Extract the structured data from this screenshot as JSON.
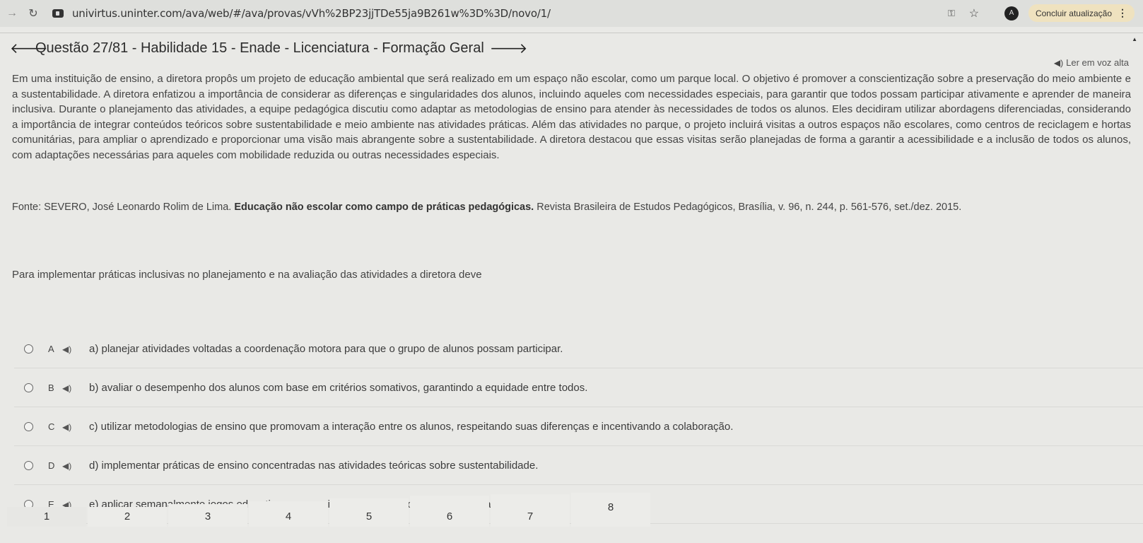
{
  "browser": {
    "url": "univirtus.uninter.com/ava/web/#/ava/provas/vVh%2BP23jjTDe55ja9B261w%3D%3D/novo/1/",
    "profile_initial": "A",
    "update_label": "Concluir atualização"
  },
  "header": {
    "title": "Questão 27/81 - Habilidade 15 - Enade - Licenciatura - Formação Geral",
    "read_aloud": "Ler em voz alta"
  },
  "question": {
    "paragraph": "Em uma instituição de ensino, a diretora propôs um projeto de educação ambiental que será realizado em um espaço não escolar, como um parque local. O objetivo é promover a conscientização sobre a preservação do meio ambiente e a sustentabilidade. A diretora enfatizou a importância de considerar as diferenças e singularidades dos alunos, incluindo aqueles com necessidades especiais, para garantir que todos possam participar ativamente e aprender de maneira inclusiva. Durante o planejamento das atividades, a equipe pedagógica discutiu como adaptar as metodologias de ensino para atender às necessidades de todos os alunos. Eles decidiram utilizar abordagens diferenciadas, considerando a importância de integrar conteúdos teóricos sobre sustentabilidade e meio ambiente nas atividades práticas. Além das atividades no parque, o projeto incluirá visitas a outros espaços não escolares, como centros de reciclagem e hortas comunitárias, para ampliar o aprendizado e proporcionar uma visão mais abrangente sobre a sustentabilidade. A diretora destacou que essas visitas serão planejadas de forma a garantir a acessibilidade e a inclusão de todos os alunos, com adaptações necessárias para aqueles com mobilidade reduzida ou outras necessidades especiais.",
    "source_prefix": "Fonte:  SEVERO, José Leonardo Rolim de Lima. ",
    "source_title": "Educação não escolar como campo de práticas pedagógicas.",
    "source_suffix": " Revista Brasileira de Estudos Pedagógicos, Brasília, v. 96, n. 244, p. 561-576, set./dez. 2015.",
    "prompt": "Para implementar práticas inclusivas no planejamento e na avaliação das atividades a diretora deve"
  },
  "options": [
    {
      "letter": "A",
      "text": "a) planejar atividades voltadas a coordenação motora para que o grupo de alunos possam participar."
    },
    {
      "letter": "B",
      "text": "b) avaliar o desempenho dos alunos com base em critérios somativos, garantindo a equidade entre todos."
    },
    {
      "letter": "C",
      "text": "c) utilizar metodologias de ensino que promovam a interação entre os alunos, respeitando suas diferenças e incentivando a colaboração."
    },
    {
      "letter": "D",
      "text": "d) implementar práticas de ensino concentradas nas atividades teóricas sobre sustentabilidade."
    },
    {
      "letter": "E",
      "text": "e) aplicar semanalmente jogos educativos como critério de avaliação em sala de aula."
    }
  ],
  "pager": [
    "1",
    "2",
    "3",
    "4",
    "5",
    "6",
    "7",
    "8"
  ]
}
